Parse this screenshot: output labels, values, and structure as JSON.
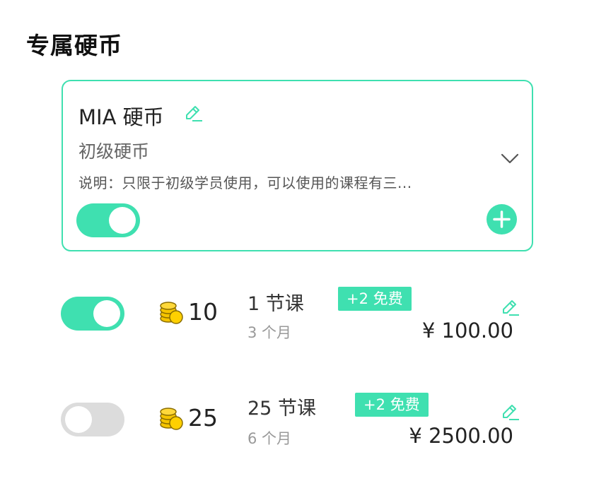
{
  "page": {
    "title": "专属硬币"
  },
  "card": {
    "title": "MIA 硬币",
    "subtitle": "初级硬币",
    "description": "说明：只限于初级学员使用，可以使用的课程有三...",
    "enabled": true,
    "icons": {
      "edit": "pencil-edit-icon",
      "expand": "chevron-down-icon",
      "add": "plus-circle-icon"
    }
  },
  "plans": [
    {
      "enabled": true,
      "coins": "10",
      "lessons": "1 节课",
      "bonus": "+2 免费",
      "duration": "3 个月",
      "price": "¥ 100.00"
    },
    {
      "enabled": false,
      "coins": "25",
      "lessons": "25 节课",
      "bonus": "+2 免费",
      "duration": "6 个月",
      "price": "¥ 2500.00"
    }
  ],
  "colors": {
    "accent": "#3fe0b0",
    "toggle_off": "#dcdcdc",
    "coin": "#f5c400"
  }
}
